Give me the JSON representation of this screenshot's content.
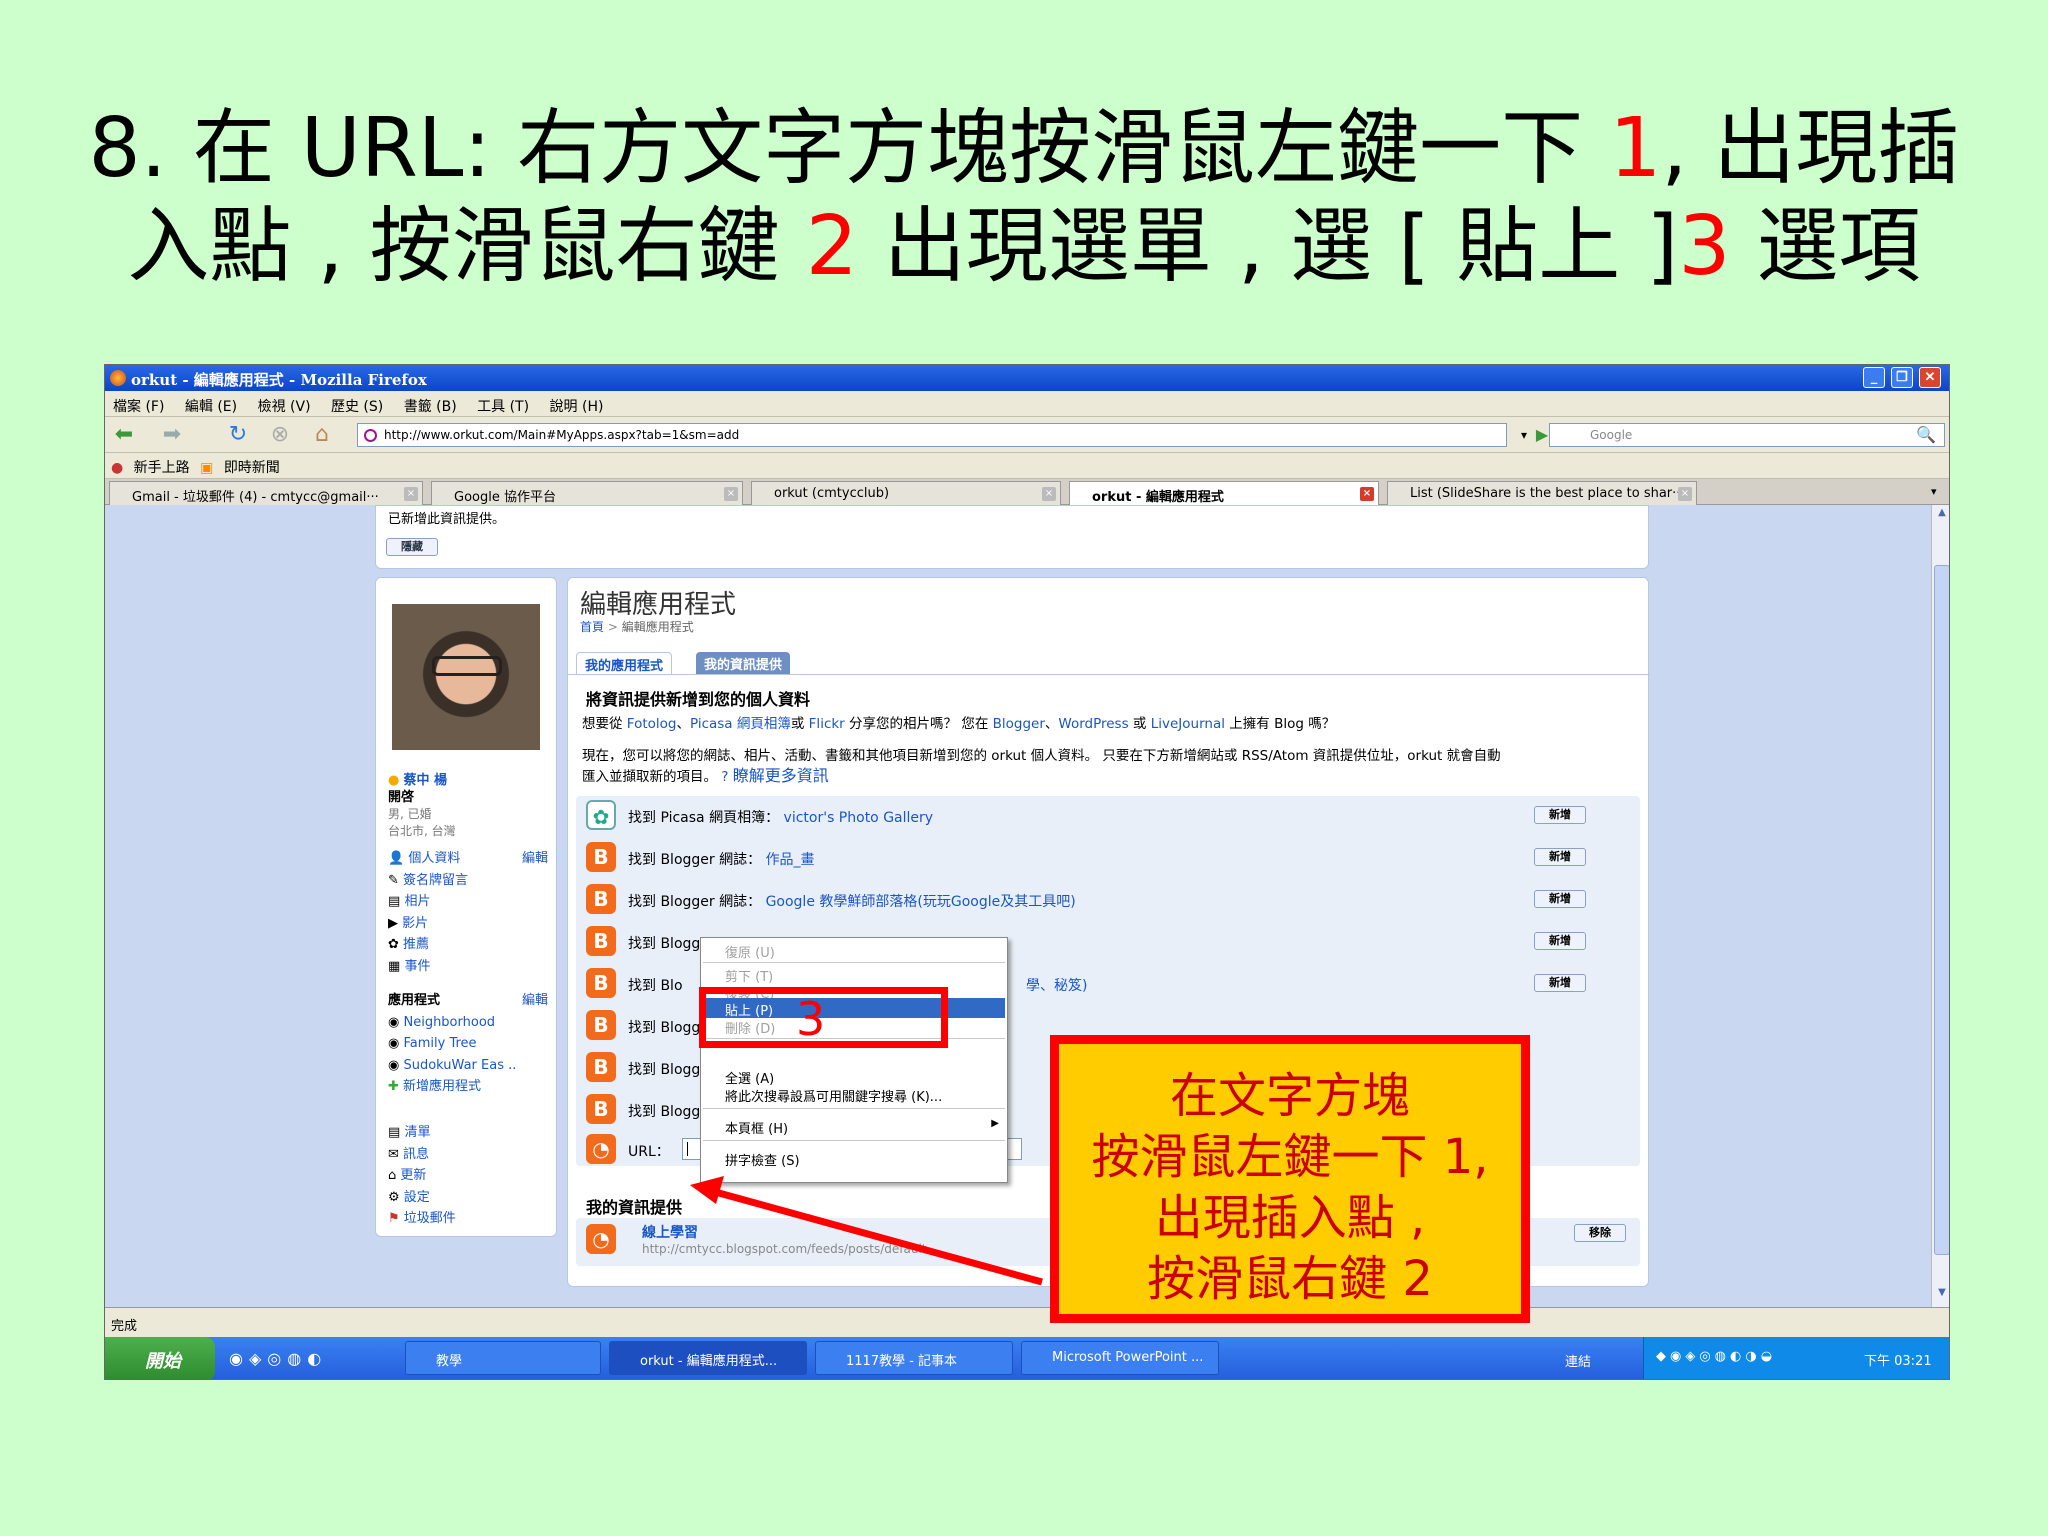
{
  "slide": {
    "line1_pre": "8. 在 URL: 右方文字方塊按滑鼠左鍵一下 ",
    "line1_num": "1",
    "line1_post": ", 出現插",
    "line2_pre": "入點 , 按滑鼠右鍵 ",
    "line2_num": "2",
    "line2_mid": " 出現選單 , 選 [ 貼上 ]",
    "line2_num3": "3",
    "line2_post": " 選項"
  },
  "browser": {
    "window_title": "orkut - 編輯應用程式 - Mozilla Firefox",
    "menu": [
      "檔案 (F)",
      "編輯 (E)",
      "檢視 (V)",
      "歷史 (S)",
      "書籤 (B)",
      "工具 (T)",
      "說明 (H)"
    ],
    "url": "http://www.orkut.com/Main#MyApps.aspx?tab=1&sm=add",
    "search_placeholder": "Google",
    "bookmarks": [
      "新手上路",
      "即時新聞"
    ],
    "tabs": [
      {
        "label": "Gmail - 垃圾郵件 (4) - cmtycc@gmail···"
      },
      {
        "label": "Google 協作平台"
      },
      {
        "label": "orkut (cmtycclub)"
      },
      {
        "label": "orkut - 編輯應用程式"
      },
      {
        "label": "List (SlideShare is the best place to shar···"
      }
    ],
    "status": "完成"
  },
  "notice": {
    "text": "已新增此資訊提供。",
    "hide_label": "隱藏"
  },
  "profile": {
    "name": "蔡中 楊",
    "status": "開啓",
    "details1": "男, 已婚",
    "details2": "台北市, 台灣",
    "nav": [
      {
        "label": "個人資料",
        "edit": "編輯"
      },
      {
        "label": "簽名牌留言"
      },
      {
        "label": "相片"
      },
      {
        "label": "影片"
      },
      {
        "label": "推薦"
      },
      {
        "label": "事件"
      }
    ],
    "apps_heading": "應用程式",
    "apps_edit": "編輯",
    "apps": [
      "Neighborhood",
      "Family Tree",
      "SudokuWar Eas ..",
      "新增應用程式"
    ],
    "bottom_nav": [
      "清單",
      "訊息",
      "更新",
      "設定",
      "垃圾郵件"
    ]
  },
  "main": {
    "title": "編輯應用程式",
    "breadcrumb_home": "首頁",
    "breadcrumb_sep": ">",
    "breadcrumb_current": "編輯應用程式",
    "tab1": "我的應用程式",
    "tab2": "我的資訊提供",
    "section_title": "將資訊提供新增到您的個人資料",
    "intro_1": "想要從 ",
    "intro_fotolog": "Fotolog",
    "intro_2": "、",
    "intro_picasa": "Picasa 網頁相簿",
    "intro_3": "或 ",
    "intro_flickr": "Flickr",
    "intro_4": " 分享您的相片嗎？ 您在 ",
    "intro_blogger": "Blogger",
    "intro_5": "、",
    "intro_wordpress": "WordPress",
    "intro_6": " 或 ",
    "intro_lj": "LiveJournal",
    "intro_7": " 上擁有 Blog 嗎？",
    "desc_line1": "現在，您可以將您的網誌、相片、活動、書籤和其他項目新增到您的 orkut 個人資料。 只要在下方新增網站或 RSS/Atom 資訊提供位址，orkut 就會自動",
    "desc_line2": "匯入並擷取新的項目。",
    "learn_more": "瞭解更多資訊",
    "feeds": [
      {
        "prefix": "找到 Picasa 網頁相簿：",
        "link": "victor's Photo Gallery",
        "button": "新增"
      },
      {
        "prefix": "找到 Blogger 網誌：",
        "link": "作品_畫",
        "button": "新增"
      },
      {
        "prefix": "找到 Blogger 網誌：",
        "link": "Google 教學鮮師部落格(玩玩Google及其工具吧)",
        "button": "新增"
      },
      {
        "prefix": "找到 Blogg",
        "link": "",
        "button": "新增"
      },
      {
        "prefix": "找到 Blo",
        "link": "學、秘笈)",
        "button": "新增"
      },
      {
        "prefix": "找到 Blogg",
        "link": ""
      },
      {
        "prefix": "找到 Blogg",
        "link": ""
      },
      {
        "prefix": "找到 Blogg",
        "link": ""
      }
    ],
    "url_label": "URL：",
    "my_feeds_heading": "我的資訊提供",
    "my_feed_title": "線上學習",
    "my_feed_url": "http://cmtycc.blogspot.com/feeds/posts/default",
    "remove_label": "移除"
  },
  "context_menu": {
    "undo": "復原 (U)",
    "cut": "剪下 (T)",
    "copy": "複製 (C)",
    "paste": "貼上 (P)",
    "delete": "刪除 (D)",
    "select_all": "全選 (A)",
    "add_keyword": "將此次搜尋設爲可用關鍵字搜尋 (K)...",
    "this_frame": "本頁框 (H)",
    "spell_check": "拼字檢查 (S)"
  },
  "annotations": {
    "step3": "3",
    "callout_line1": "在文字方塊",
    "callout_line2": "按滑鼠左鍵一下 1,",
    "callout_line3": "出現插入點 ,",
    "callout_line4": "按滑鼠右鍵 2"
  },
  "taskbar": {
    "start": "開始",
    "items": [
      "教學",
      "orkut - 編輯應用程式...",
      "1117教學 - 記事本",
      "Microsoft PowerPoint ..."
    ],
    "tray_links": "連結",
    "clock": "下午 03:21"
  },
  "colors": {
    "slide_bg": "#ccffcc",
    "highlight_red": "#ff0000",
    "callout_bg": "#ffcc00",
    "link_blue": "#1a56c8"
  }
}
